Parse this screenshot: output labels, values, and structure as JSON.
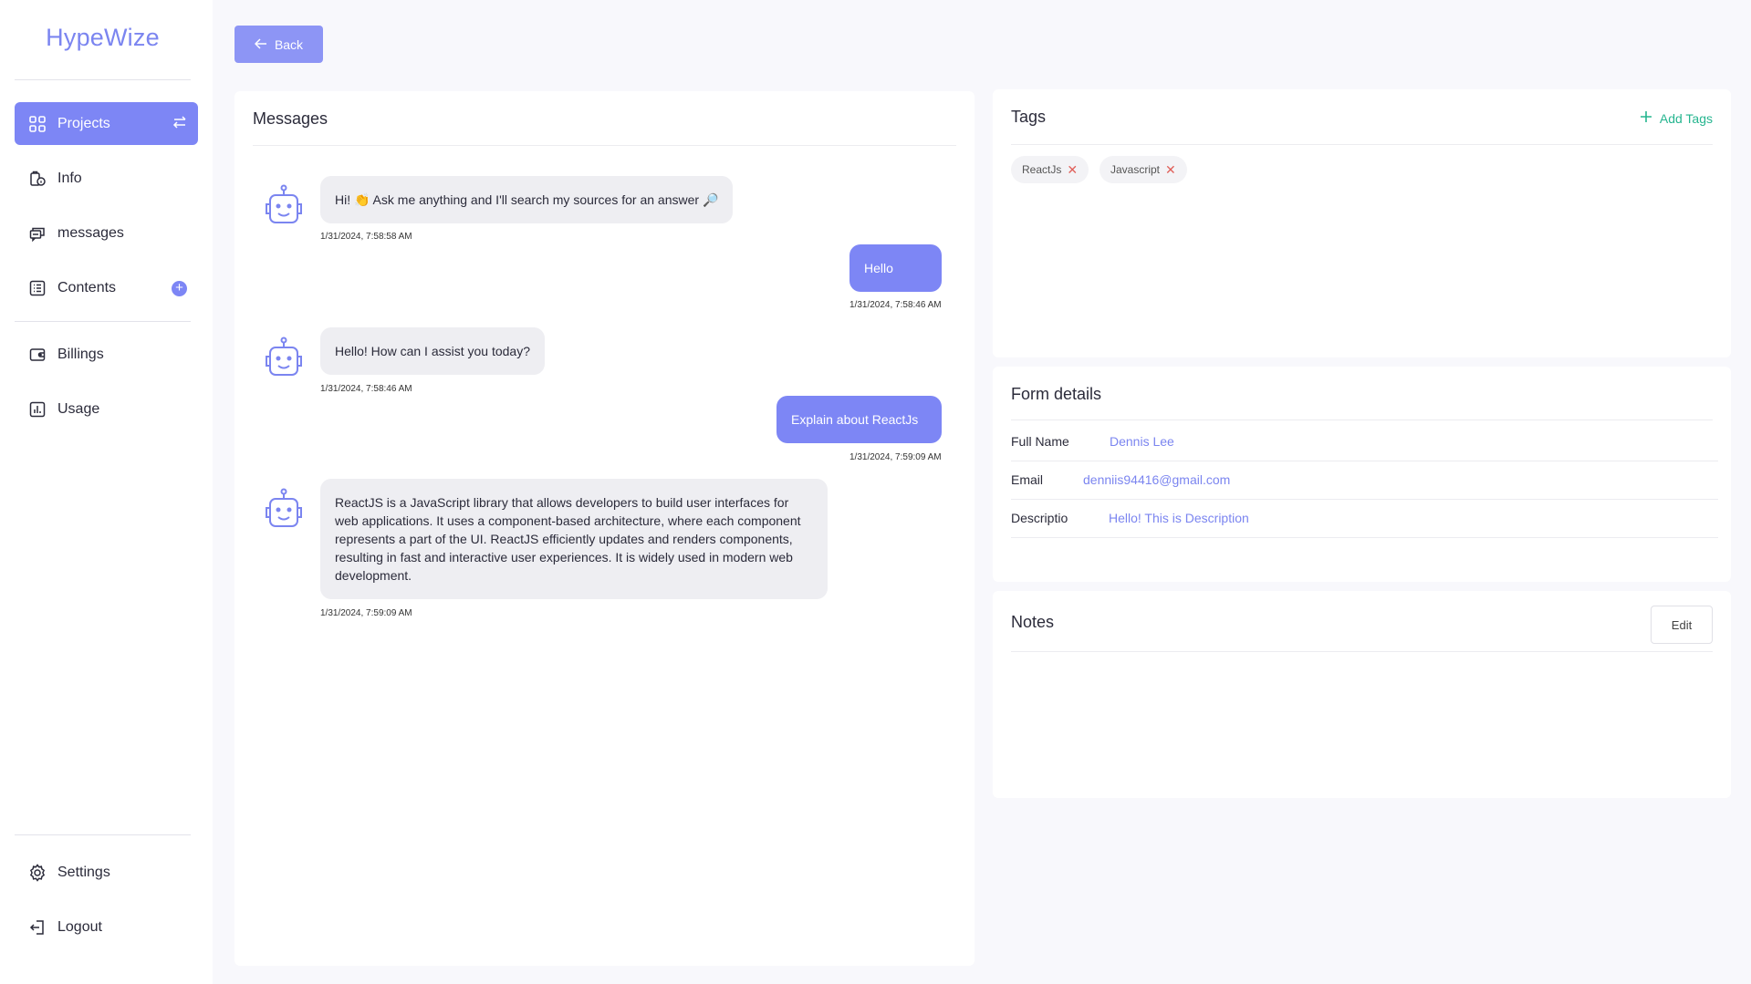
{
  "brand": "HypeWize",
  "sidebar": {
    "items": [
      {
        "label": "Projects",
        "icon": "grid-icon"
      },
      {
        "label": "Info",
        "icon": "info-badge-icon"
      },
      {
        "label": "messages",
        "icon": "chat-icon"
      },
      {
        "label": "Contents",
        "icon": "list-icon"
      },
      {
        "label": "Billings",
        "icon": "wallet-icon"
      },
      {
        "label": "Usage",
        "icon": "bar-chart-icon"
      }
    ],
    "bottom": [
      {
        "label": "Settings",
        "icon": "gear-icon"
      },
      {
        "label": "Logout",
        "icon": "logout-icon"
      }
    ]
  },
  "back_label": "Back",
  "messages": {
    "title": "Messages",
    "items": [
      {
        "from": "bot",
        "text": "Hi! 👏 Ask me anything and I'll search my sources for an answer 🔎",
        "time": "1/31/2024, 7:58:58 AM"
      },
      {
        "from": "user",
        "text": "Hello",
        "time": "1/31/2024, 7:58:46 AM"
      },
      {
        "from": "bot",
        "text": "Hello! How can I assist you today?",
        "time": "1/31/2024, 7:58:46 AM"
      },
      {
        "from": "user",
        "text": "Explain about ReactJs",
        "time": "1/31/2024, 7:59:09 AM"
      },
      {
        "from": "bot",
        "text": "ReactJS is a JavaScript library that allows developers to build user interfaces for web applications. It uses a component-based architecture, where each component represents a part of the UI. ReactJS efficiently updates and renders components, resulting in fast and interactive user experiences. It is widely used in modern web development.",
        "time": "1/31/2024, 7:59:09 AM"
      }
    ]
  },
  "tags": {
    "title": "Tags",
    "add_label": "Add Tags",
    "items": [
      "ReactJs",
      "Javascript"
    ]
  },
  "form": {
    "title": "Form details",
    "rows": [
      {
        "label": "Full Name",
        "value": "Dennis Lee"
      },
      {
        "label": "Email",
        "value": "denniis94416@gmail.com"
      },
      {
        "label": "Descriptio",
        "value": "Hello! This is Description"
      }
    ]
  },
  "notes": {
    "title": "Notes",
    "edit_label": "Edit"
  },
  "colors": {
    "accent": "#7d86f5",
    "brand": "#7b85f0",
    "add_tags": "#25b58f",
    "remove_tag": "#e0605a"
  }
}
